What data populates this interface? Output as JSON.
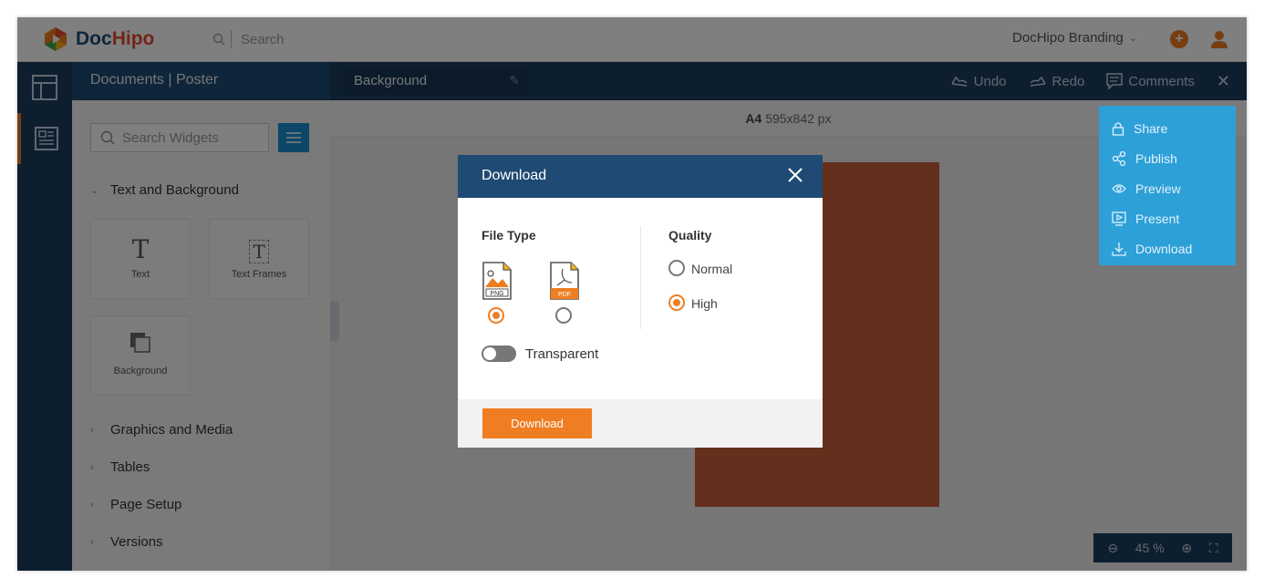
{
  "app": {
    "logo_text_doc": "Doc",
    "logo_text_hipo": "Hipo",
    "search_placeholder": "Search",
    "brand_label": "DocHipo Branding"
  },
  "subheader": {
    "breadcrumb": "Documents | Poster",
    "document_name": "Background",
    "actions": {
      "undo": "Undo",
      "redo": "Redo",
      "comments": "Comments"
    }
  },
  "widgets": {
    "search_placeholder": "Search Widgets",
    "sections": {
      "text_background": "Text and Background",
      "graphics_media": "Graphics and Media",
      "tables": "Tables",
      "page_setup": "Page Setup",
      "versions": "Versions"
    },
    "tiles": {
      "text": "Text",
      "text_frames": "Text Frames",
      "background": "Background"
    }
  },
  "canvas": {
    "size_name": "A4",
    "size_px": "595x842 px",
    "poster_color": "#c85f39",
    "zoom_value": "45",
    "zoom_unit": "%"
  },
  "share_menu": {
    "items": [
      "Share",
      "Publish",
      "Preview",
      "Present",
      "Download"
    ]
  },
  "dialog": {
    "title": "Download",
    "file_type_label": "File Type",
    "file_types": [
      {
        "name": "PNG",
        "selected": true
      },
      {
        "name": "PDF",
        "selected": false
      }
    ],
    "quality_label": "Quality",
    "quality_options": [
      {
        "label": "Normal",
        "selected": false
      },
      {
        "label": "High",
        "selected": true
      }
    ],
    "transparent_label": "Transparent",
    "transparent_on": false,
    "download_button": "Download"
  },
  "colors": {
    "accent": "#ef7d22",
    "navy": "#1a3d5f",
    "menu_blue": "#2da0d8"
  }
}
